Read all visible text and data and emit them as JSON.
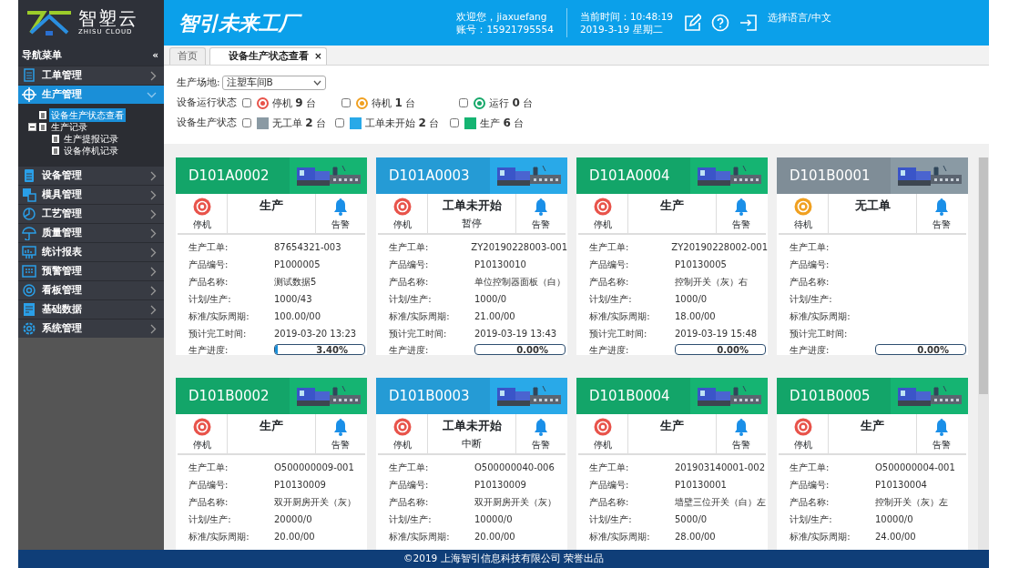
{
  "logo": {
    "name": "智塑云",
    "sub": "ZHISU CLOUD"
  },
  "header": {
    "title": "智引未来工厂",
    "welcome": "欢迎您，jiaxuefang",
    "account": "账号：15921795554",
    "time": "当前时间：10:48:19",
    "date": "2019-3-19 星期二",
    "language": "选择语言/中文"
  },
  "sidebar": {
    "title": "导航菜单",
    "collapse": "«",
    "items": [
      {
        "label": "工单管理",
        "selected": false,
        "expanded": false
      },
      {
        "label": "生产管理",
        "selected": true,
        "expanded": true,
        "children": [
          {
            "label": "设备生产状态查看",
            "selected": true
          },
          {
            "label": "生产记录",
            "selected": false,
            "expanded": true,
            "children": [
              {
                "label": "生产提报记录",
                "selected": false
              },
              {
                "label": "设备停机记录",
                "selected": false
              }
            ]
          }
        ]
      },
      {
        "label": "设备管理",
        "selected": false,
        "expanded": false
      },
      {
        "label": "模具管理",
        "selected": false,
        "expanded": false
      },
      {
        "label": "工艺管理",
        "selected": false,
        "expanded": false
      },
      {
        "label": "质量管理",
        "selected": false,
        "expanded": false
      },
      {
        "label": "统计报表",
        "selected": false,
        "expanded": false
      },
      {
        "label": "预警管理",
        "selected": false,
        "expanded": false
      },
      {
        "label": "看板管理",
        "selected": false,
        "expanded": false
      },
      {
        "label": "基础数据",
        "selected": false,
        "expanded": false
      },
      {
        "label": "系统管理",
        "selected": false,
        "expanded": false
      }
    ]
  },
  "tabs": [
    {
      "label": "首页",
      "selected": false
    },
    {
      "label": "设备生产状态查看",
      "selected": true,
      "close": "×"
    }
  ],
  "filters": {
    "site": {
      "label": "生产场地:",
      "value": "注塑车间B"
    },
    "run_status": {
      "label": "设备运行状态",
      "options": [
        {
          "kind": "ring",
          "checked": false,
          "label": "停机",
          "count": "9",
          "unit": "台",
          "color": "#e8534a"
        },
        {
          "kind": "ring",
          "checked": false,
          "label": "待机",
          "count": "1",
          "unit": "台",
          "color": "#f0a020"
        },
        {
          "kind": "ring",
          "checked": false,
          "label": "运行",
          "count": "0",
          "unit": "台",
          "color": "#17a86a"
        }
      ]
    },
    "production_status": {
      "label": "设备生产状态",
      "options": [
        {
          "kind": "square",
          "checked": false,
          "label": "无工单",
          "count": "2",
          "unit": "台",
          "color": "#8a9aa4"
        },
        {
          "kind": "square",
          "checked": false,
          "label": "工单未开始",
          "count": "2",
          "unit": "台",
          "color": "#29a9e8"
        },
        {
          "kind": "square",
          "checked": false,
          "label": "生产",
          "count": "6",
          "unit": "台",
          "color": "#15b472"
        }
      ]
    }
  },
  "cards": [
    {
      "id": "D101A0002",
      "color": "#15b472",
      "run": {
        "label": "停机",
        "color": "#e8534a"
      },
      "state": "生产",
      "alarm": "告警",
      "fields": [
        {
          "label": "生产工单:",
          "value": "87654321-003"
        },
        {
          "label": "产品编号:",
          "value": "P1000005"
        },
        {
          "label": "产品名称:",
          "value": "测试数据5"
        },
        {
          "label": "计划/生产:",
          "value": "1000/43"
        },
        {
          "label": "标准/实际周期:",
          "value": "100.00/00"
        },
        {
          "label": "预计完工时间:",
          "value": "2019-03-20 13:23"
        }
      ],
      "progress": {
        "label": "生产进度:",
        "text": "3.40%",
        "level": 0.034
      }
    },
    {
      "id": "D101A0003",
      "color": "#29a9e8",
      "run": {
        "label": "停机",
        "color": "#e8534a"
      },
      "state": "工单未开始",
      "sub": "暂停",
      "alarm": "告警",
      "fields": [
        {
          "label": "生产工单:",
          "value": "ZY20190228003-001"
        },
        {
          "label": "产品编号:",
          "value": "P10130010"
        },
        {
          "label": "产品名称:",
          "value": "单位控制器面板（白）"
        },
        {
          "label": "计划/生产:",
          "value": "1000/0"
        },
        {
          "label": "标准/实际周期:",
          "value": "21.00/00"
        },
        {
          "label": "预计完工时间:",
          "value": "2019-03-19 13:43"
        }
      ],
      "progress": {
        "label": "生产进度:",
        "text": "0.00%",
        "level": 0
      }
    },
    {
      "id": "D101A0004",
      "color": "#15b472",
      "run": {
        "label": "停机",
        "color": "#e8534a"
      },
      "state": "生产",
      "alarm": "告警",
      "fields": [
        {
          "label": "生产工单:",
          "value": "ZY20190228002-001"
        },
        {
          "label": "产品编号:",
          "value": "P10130005"
        },
        {
          "label": "产品名称:",
          "value": "控制开关（灰）右"
        },
        {
          "label": "计划/生产:",
          "value": "1000/0"
        },
        {
          "label": "标准/实际周期:",
          "value": "18.00/00"
        },
        {
          "label": "预计完工时间:",
          "value": "2019-03-19 15:48"
        }
      ],
      "progress": {
        "label": "生产进度:",
        "text": "0.00%",
        "level": 0
      }
    },
    {
      "id": "D101B0001",
      "color": "#8a9aa4",
      "run": {
        "label": "待机",
        "color": "#f0a020"
      },
      "state": "无工单",
      "alarm": "告警",
      "fields": [
        {
          "label": "生产工单:"
        },
        {
          "label": "产品编号:"
        },
        {
          "label": "产品名称:"
        },
        {
          "label": "计划/生产:"
        },
        {
          "label": "标准/实际周期:"
        },
        {
          "label": "预计完工时间:"
        }
      ],
      "progress": {
        "label": "生产进度:",
        "text": "0.00%",
        "level": 0
      }
    },
    {
      "id": "D101B0002",
      "color": "#15b472",
      "run": {
        "label": "停机",
        "color": "#e8534a"
      },
      "state": "生产",
      "alarm": "告警",
      "fields": [
        {
          "label": "生产工单:",
          "value": "O500000009-001"
        },
        {
          "label": "产品编号:",
          "value": "P10130009"
        },
        {
          "label": "产品名称:",
          "value": "双开厨房开关（灰）"
        },
        {
          "label": "计划/生产:",
          "value": "20000/0"
        },
        {
          "label": "标准/实际周期:",
          "value": "20.00/00"
        }
      ]
    },
    {
      "id": "D101B0003",
      "color": "#29a9e8",
      "run": {
        "label": "停机",
        "color": "#e8534a"
      },
      "state": "工单未开始",
      "sub": "中断",
      "alarm": "告警",
      "fields": [
        {
          "label": "生产工单:",
          "value": "O500000040-006"
        },
        {
          "label": "产品编号:",
          "value": "P10130009"
        },
        {
          "label": "产品名称:",
          "value": "双开厨房开关（灰）"
        },
        {
          "label": "计划/生产:",
          "value": "10000/0"
        },
        {
          "label": "标准/实际周期:",
          "value": "20.00/00"
        }
      ]
    },
    {
      "id": "D101B0004",
      "color": "#15b472",
      "run": {
        "label": "停机",
        "color": "#e8534a"
      },
      "state": "生产",
      "alarm": "告警",
      "fields": [
        {
          "label": "生产工单:",
          "value": "201903140001-002"
        },
        {
          "label": "产品编号:",
          "value": "P10130001"
        },
        {
          "label": "产品名称:",
          "value": "墙壁三位开关（白）左"
        },
        {
          "label": "计划/生产:",
          "value": "5000/0"
        },
        {
          "label": "标准/实际周期:",
          "value": "28.00/00"
        }
      ]
    },
    {
      "id": "D101B0005",
      "color": "#15b472",
      "run": {
        "label": "停机",
        "color": "#e8534a"
      },
      "state": "生产",
      "alarm": "告警",
      "fields": [
        {
          "label": "生产工单:",
          "value": "O500000004-001"
        },
        {
          "label": "产品编号:",
          "value": "P10130004"
        },
        {
          "label": "产品名称:",
          "value": "控制开关（灰）左"
        },
        {
          "label": "计划/生产:",
          "value": "10000/0"
        },
        {
          "label": "标准/实际周期:",
          "value": "24.00/00"
        }
      ]
    }
  ],
  "footer": "©2019 上海智引信息科技有限公司 荣誉出品"
}
